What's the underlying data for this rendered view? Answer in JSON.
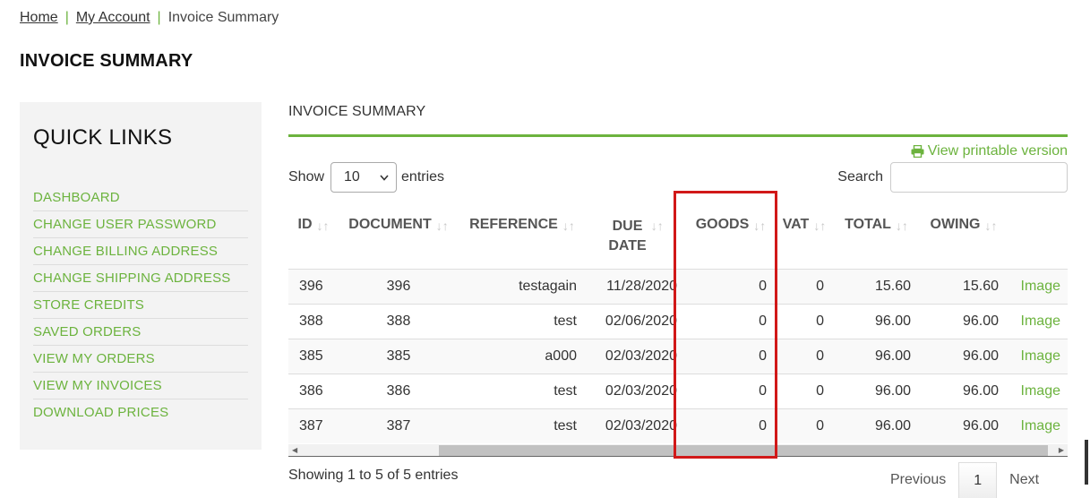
{
  "breadcrumb": {
    "home": "Home",
    "account": "My Account",
    "current": "Invoice Summary",
    "separator": "|"
  },
  "page_title": "INVOICE SUMMARY",
  "quick_links": {
    "heading": "QUICK LINKS",
    "items": [
      "DASHBOARD",
      "CHANGE USER PASSWORD",
      "CHANGE BILLING ADDRESS",
      "CHANGE SHIPPING ADDRESS",
      "STORE CREDITS",
      "SAVED ORDERS",
      "VIEW MY ORDERS",
      "VIEW MY INVOICES",
      "DOWNLOAD PRICES"
    ]
  },
  "panel_title": "INVOICE SUMMARY",
  "printable_label": "View printable version",
  "length": {
    "show_label": "Show",
    "value": "10",
    "entries_label": "entries"
  },
  "search": {
    "label": "Search",
    "value": ""
  },
  "table": {
    "columns": [
      {
        "label": "ID",
        "label2": ""
      },
      {
        "label": "DOCUMENT",
        "label2": ""
      },
      {
        "label": "REFERENCE",
        "label2": ""
      },
      {
        "label": "DUE",
        "label2": "DATE"
      },
      {
        "label": "GOODS",
        "label2": ""
      },
      {
        "label": "VAT",
        "label2": ""
      },
      {
        "label": "TOTAL",
        "label2": ""
      },
      {
        "label": "OWING",
        "label2": ""
      }
    ],
    "rows": [
      {
        "id": "396",
        "document": "396",
        "reference": "testagain",
        "due_date": "11/28/2020",
        "goods": "0",
        "vat": "0",
        "total": "15.60",
        "owing": "15.60",
        "link": "Image"
      },
      {
        "id": "388",
        "document": "388",
        "reference": "test",
        "due_date": "02/06/2020",
        "goods": "0",
        "vat": "0",
        "total": "96.00",
        "owing": "96.00",
        "link": "Image"
      },
      {
        "id": "385",
        "document": "385",
        "reference": "a000",
        "due_date": "02/03/2020",
        "goods": "0",
        "vat": "0",
        "total": "96.00",
        "owing": "96.00",
        "link": "Image"
      },
      {
        "id": "386",
        "document": "386",
        "reference": "test",
        "due_date": "02/03/2020",
        "goods": "0",
        "vat": "0",
        "total": "96.00",
        "owing": "96.00",
        "link": "Image"
      },
      {
        "id": "387",
        "document": "387",
        "reference": "test",
        "due_date": "02/03/2020",
        "goods": "0",
        "vat": "0",
        "total": "96.00",
        "owing": "96.00",
        "link": "Image"
      }
    ]
  },
  "info": "Showing 1 to 5 of 5 entries",
  "pagination": {
    "previous": "Previous",
    "page": "1",
    "next": "Next"
  },
  "colors": {
    "accent": "#6cb33e",
    "highlight": "#d11818",
    "sidebar_bg": "#f3f3f3"
  }
}
